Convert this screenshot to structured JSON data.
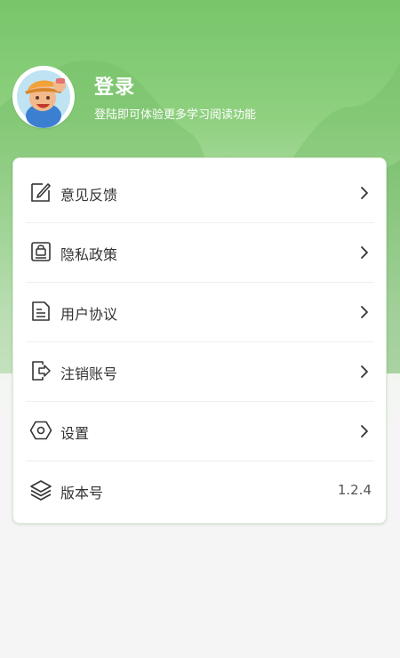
{
  "header": {
    "title": "登录",
    "subtitle": "登陆即可体验更多学习阅读功能",
    "avatar_icon": "cartoon-boy-avatar-icon"
  },
  "menu": {
    "items": [
      {
        "label": "意见反馈",
        "icon": "edit-icon",
        "trailing": "chevron-right-icon"
      },
      {
        "label": "隐私政策",
        "icon": "privacy-lock-icon",
        "trailing": "chevron-right-icon"
      },
      {
        "label": "用户协议",
        "icon": "document-icon",
        "trailing": "chevron-right-icon"
      },
      {
        "label": "注销账号",
        "icon": "logout-icon",
        "trailing": "chevron-right-icon"
      },
      {
        "label": "设置",
        "icon": "settings-hexagon-icon",
        "trailing": "chevron-right-icon"
      },
      {
        "label": "版本号",
        "icon": "layers-icon",
        "value": "1.2.4"
      }
    ]
  },
  "colors": {
    "accent_green": "#77c66a",
    "text_primary": "#333333",
    "card_background": "#ffffff",
    "page_background": "#f5f5f5"
  }
}
